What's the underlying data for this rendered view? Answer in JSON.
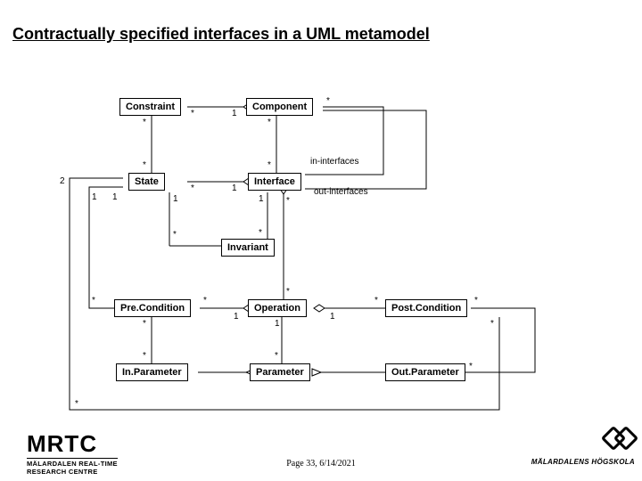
{
  "title": "Contractually specified interfaces in a UML metamodel",
  "boxes": {
    "constraint": "Constraint",
    "component": "Component",
    "state": "State",
    "interface": "Interface",
    "invariant": "Invariant",
    "precondition": "Pre.Condition",
    "operation": "Operation",
    "postcondition": "Post.Condition",
    "inparameter": "In.Parameter",
    "parameter": "Parameter",
    "outparameter": "Out.Parameter"
  },
  "role_labels": {
    "in_interfaces": "in-interfaces",
    "out_interfaces": "out-interfaces"
  },
  "multiplicities": {
    "star": "*",
    "one": "1",
    "two": "2"
  },
  "footer": {
    "page": "Page 33, 6/14/2021",
    "left_logo_main": "MRTC",
    "left_logo_sub": "MÄLARDALEN REAL-TIME\nRESEARCH CENTRE",
    "right_logo": "MÄLARDALENS HÖGSKOLA"
  },
  "chart_data": {
    "type": "table",
    "description": "UML class diagram: contractually specified interfaces metamodel",
    "classes": [
      "Constraint",
      "Component",
      "State",
      "Interface",
      "Invariant",
      "Pre.Condition",
      "Operation",
      "Post.Condition",
      "In.Parameter",
      "Parameter",
      "Out.Parameter"
    ],
    "associations": [
      {
        "from": "Constraint",
        "to": "Component",
        "kind": "aggregation",
        "mult_from": "*",
        "mult_to": "1"
      },
      {
        "from": "Component",
        "to": "Interface",
        "role": "in-interfaces",
        "mult_from": "*",
        "mult_to": "*"
      },
      {
        "from": "Component",
        "to": "Interface",
        "role": "out-interfaces",
        "mult_from": "*",
        "mult_to": "*"
      },
      {
        "from": "State",
        "to": "Constraint",
        "mult_from": "*",
        "mult_to": "*"
      },
      {
        "from": "State",
        "to": "Interface",
        "kind": "aggregation",
        "mult_from": "*",
        "mult_to": "1"
      },
      {
        "from": "State",
        "to": "Invariant",
        "mult_from": "1",
        "mult_to": "*"
      },
      {
        "from": "Interface",
        "to": "Invariant",
        "mult_from": "1",
        "mult_to": "*"
      },
      {
        "from": "State",
        "to": "Pre.Condition",
        "mult_from": "1",
        "mult_to": "*"
      },
      {
        "from": "State",
        "to": "Post.Condition",
        "mult": "2"
      },
      {
        "from": "Pre.Condition",
        "to": "Operation",
        "kind": "aggregation",
        "mult_from": "*",
        "mult_to": "1"
      },
      {
        "from": "Post.Condition",
        "to": "Operation",
        "kind": "aggregation",
        "mult_from": "*",
        "mult_to": "1"
      },
      {
        "from": "Operation",
        "to": "Interface",
        "kind": "aggregation",
        "mult_from": "*",
        "mult_to": "*"
      },
      {
        "from": "Operation",
        "to": "Parameter",
        "mult_from": "1",
        "mult_to": "*"
      },
      {
        "from": "Pre.Condition",
        "to": "In.Parameter",
        "mult_from": "*",
        "mult_to": "*"
      },
      {
        "from": "Post.Condition",
        "to": "Out.Parameter",
        "mult_from": "*",
        "mult_to": "*"
      },
      {
        "from": "In.Parameter",
        "to": "Parameter",
        "kind": "generalization"
      },
      {
        "from": "Out.Parameter",
        "to": "Parameter",
        "kind": "generalization"
      }
    ]
  }
}
